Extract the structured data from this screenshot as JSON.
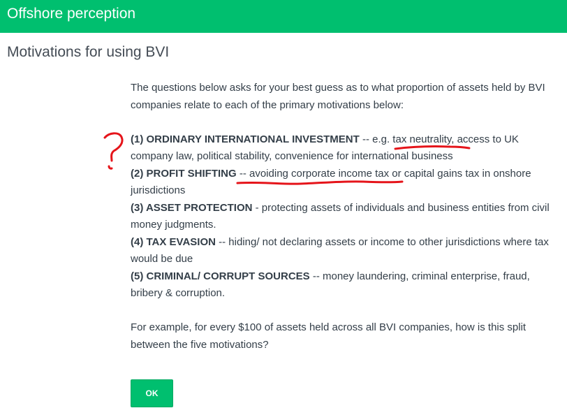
{
  "header": {
    "title": "Offshore perception"
  },
  "page": {
    "title": "Motivations for using BVI"
  },
  "question": {
    "intro": "The questions below asks for your best guess as to what proportion of assets held by BVI companies relate to each of the  primary motivations below:",
    "motivations": [
      {
        "head": "(1) ORDINARY INTERNATIONAL INVESTMENT",
        "body": "  --  e.g. tax neutrality, access to UK company law, political stability, convenience for international business"
      },
      {
        "head": "(2) PROFIT SHIFTING",
        "body": " --  avoiding corporate income tax or capital gains tax in onshore jurisdictions"
      },
      {
        "head": "(3) ASSET PROTECTION",
        "body": " - protecting assets of individuals and business entities from civil money judgments."
      },
      {
        "head": "(4) TAX EVASION",
        "body": " --  hiding/ not declaring assets or income to other jurisdictions where tax would be due"
      },
      {
        "head": "(5) CRIMINAL/ CORRUPT SOURCES",
        "body": "  -- money laundering, criminal enterprise, fraud, bribery & corruption."
      }
    ],
    "example": "For example, for every $100 of assets held across all BVI companies, how is this split between the five motivations?"
  },
  "actions": {
    "ok_label": "OK"
  },
  "annotation": {
    "mark": "?",
    "color": "#e5141a"
  },
  "colors": {
    "brand": "#00bf6f",
    "text": "#333e48"
  }
}
